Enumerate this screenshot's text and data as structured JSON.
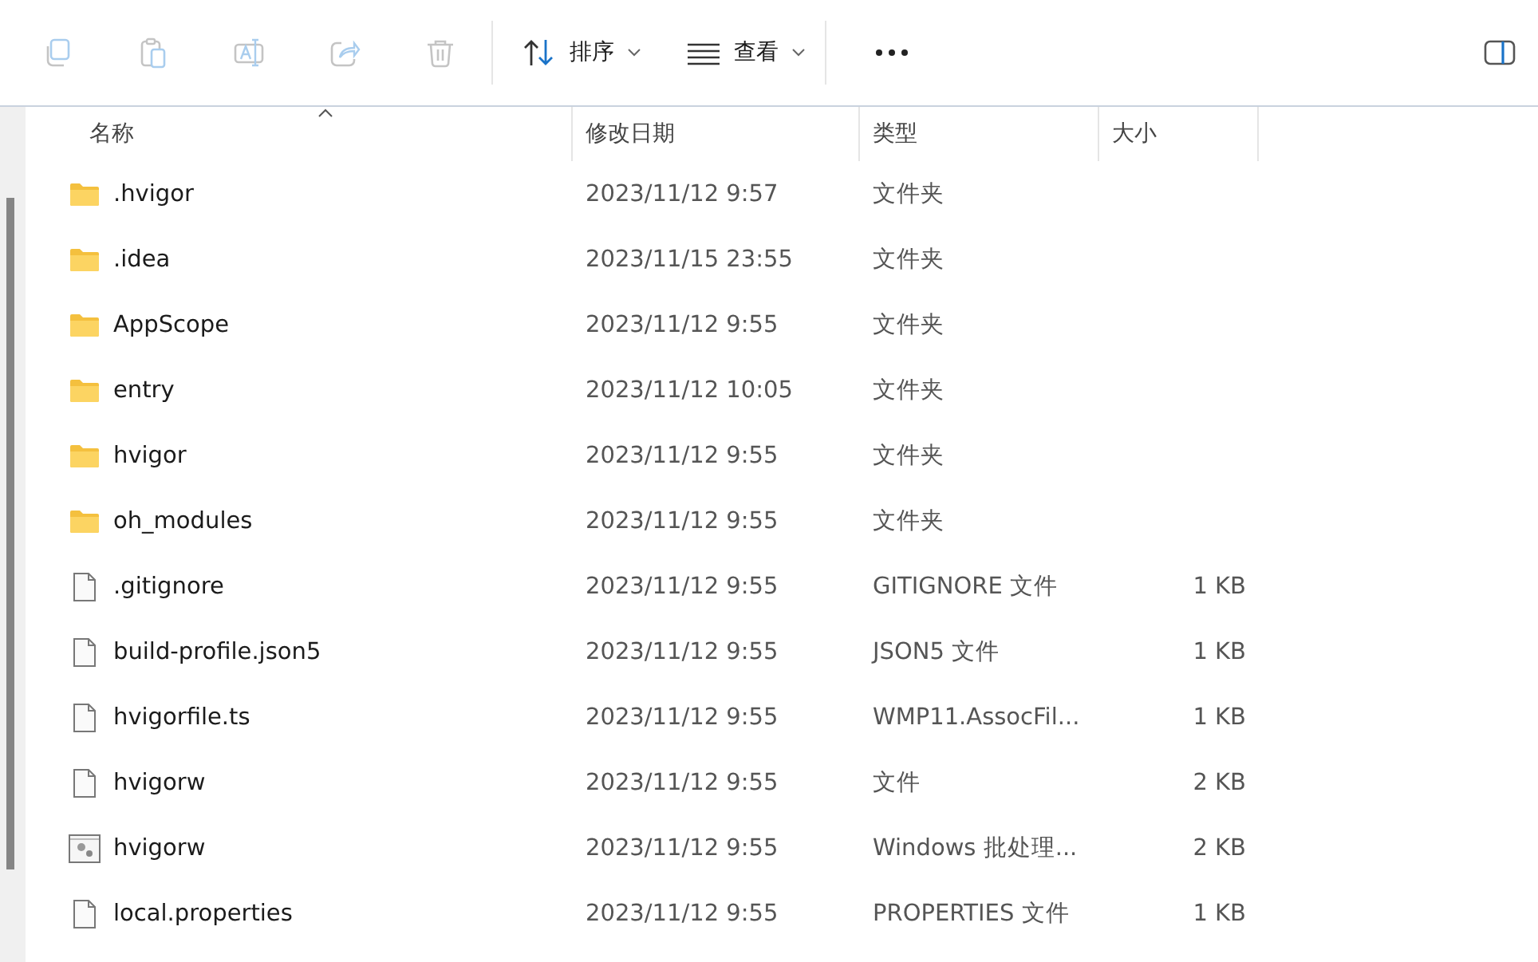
{
  "toolbar": {
    "actions": [
      {
        "kind": "copy",
        "disabled": true
      },
      {
        "kind": "paste",
        "disabled": true
      },
      {
        "kind": "rename",
        "disabled": true
      },
      {
        "kind": "share",
        "disabled": true
      },
      {
        "kind": "delete",
        "disabled": true
      }
    ],
    "menus": [
      {
        "kind": "sort",
        "label": "排序"
      },
      {
        "kind": "view",
        "label": "查看"
      }
    ]
  },
  "table": {
    "columns": [
      {
        "label": "名称",
        "sorted": true
      },
      {
        "label": "修改日期",
        "sorted": false
      },
      {
        "label": "类型",
        "sorted": false
      },
      {
        "label": "大小",
        "sorted": false
      }
    ],
    "rows": [
      {
        "kind": "folder",
        "name": ".hvigor",
        "date": "2023/11/12 9:57",
        "type": "文件夹"
      },
      {
        "kind": "folder",
        "name": ".idea",
        "date": "2023/11/15 23:55",
        "type": "文件夹"
      },
      {
        "kind": "folder",
        "name": "AppScope",
        "date": "2023/11/12 9:55",
        "type": "文件夹"
      },
      {
        "kind": "folder",
        "name": "entry",
        "date": "2023/11/12 10:05",
        "type": "文件夹"
      },
      {
        "kind": "folder",
        "name": "hvigor",
        "date": "2023/11/12 9:55",
        "type": "文件夹"
      },
      {
        "kind": "folder",
        "name": "oh_modules",
        "date": "2023/11/12 9:55",
        "type": "文件夹"
      },
      {
        "kind": "file",
        "name": ".gitignore",
        "date": "2023/11/12 9:55",
        "type": "GITIGNORE 文件",
        "size": "1 KB"
      },
      {
        "kind": "file",
        "name": "build-profile.json5",
        "date": "2023/11/12 9:55",
        "type": "JSON5 文件",
        "size": "1 KB"
      },
      {
        "kind": "file",
        "name": "hvigorfile.ts",
        "date": "2023/11/12 9:55",
        "type": "WMP11.AssocFil...",
        "size": "1 KB"
      },
      {
        "kind": "file",
        "name": "hvigorw",
        "date": "2023/11/12 9:55",
        "type": "文件",
        "size": "2 KB"
      },
      {
        "kind": "script",
        "name": "hvigorw",
        "date": "2023/11/12 9:55",
        "type": "Windows 批处理...",
        "size": "2 KB"
      },
      {
        "kind": "file",
        "name": "local.properties",
        "date": "2023/11/12 9:55",
        "type": "PROPERTIES 文件",
        "size": "1 KB"
      }
    ]
  }
}
